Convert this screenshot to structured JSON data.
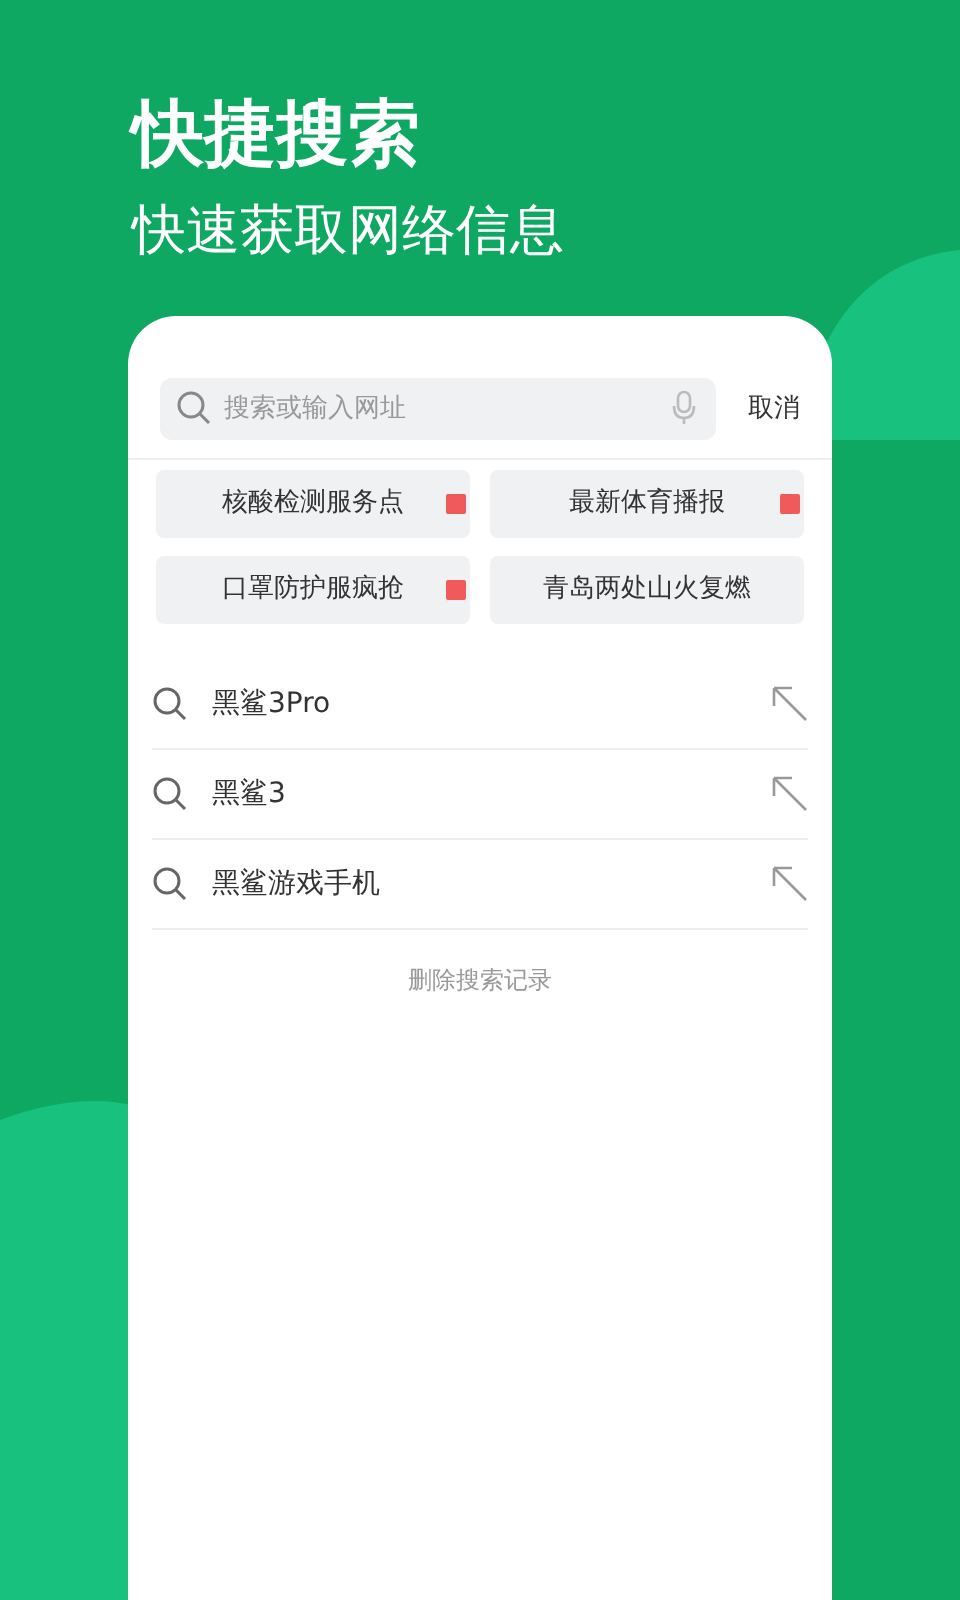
{
  "headline": "快捷搜索",
  "subheadline": "快速获取网络信息",
  "search": {
    "placeholder": "搜索或输入网址",
    "cancel": "取消"
  },
  "hot_topics": [
    {
      "label": "核酸检测服务点",
      "recommended": true
    },
    {
      "label": "最新体育播报",
      "recommended": true
    },
    {
      "label": "口罩防护服疯抢",
      "recommended": true
    },
    {
      "label": "青岛两处山火复燃",
      "recommended": false
    }
  ],
  "history": [
    {
      "query": "黑鲨3Pro"
    },
    {
      "query": "黑鲨3"
    },
    {
      "query": "黑鲨游戏手机"
    }
  ],
  "clear_history": "删除搜索记录"
}
